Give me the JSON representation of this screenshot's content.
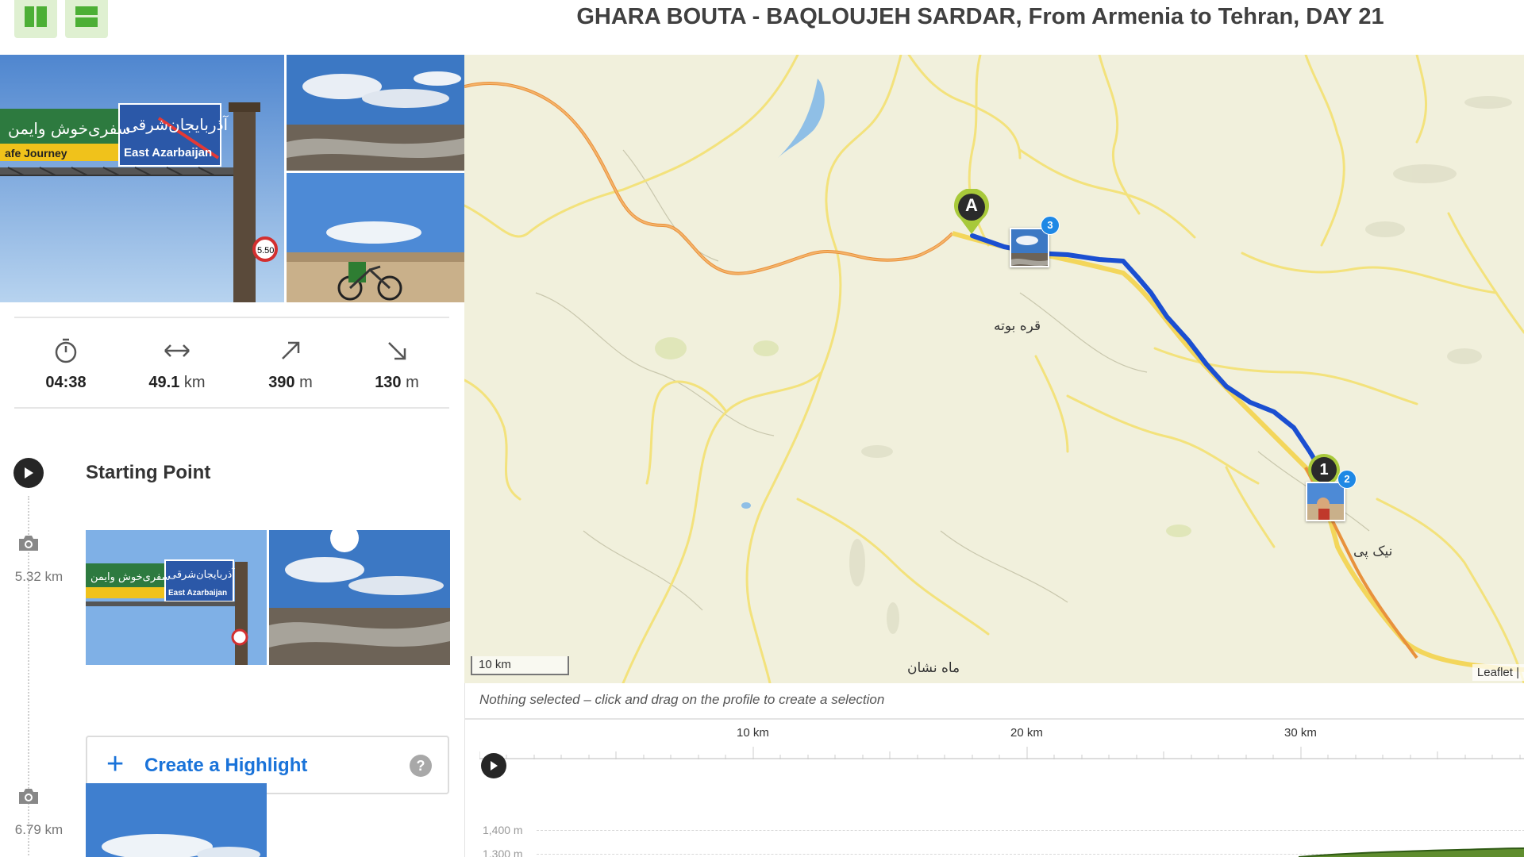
{
  "header": {
    "title": "GHARA BOUTA - BAQLOUJEH SARDAR, From Armenia to Tehran, DAY 21",
    "view_buttons": [
      "split-view-icon",
      "stacked-view-icon"
    ],
    "accent_color": "#dff0d1"
  },
  "stats": {
    "duration": {
      "icon": "stopwatch-icon",
      "value": "04:38",
      "unit": ""
    },
    "distance": {
      "icon": "distance-arrows-icon",
      "value": "49.1",
      "unit": "km"
    },
    "uphill": {
      "icon": "arrow-up-right-icon",
      "value": "390",
      "unit": "m"
    },
    "downhill": {
      "icon": "arrow-down-right-icon",
      "value": "130",
      "unit": "m"
    }
  },
  "timeline": {
    "start_label": "Starting Point",
    "items": [
      {
        "type": "photos",
        "distance": "5.32 km",
        "photo_count": 2
      },
      {
        "type": "photos",
        "distance": "6.79 km",
        "photo_count": 1
      }
    ],
    "highlight_button": {
      "label": "Create a Highlight",
      "help": "?"
    }
  },
  "map": {
    "places": [
      "قره بوته",
      "نیک پی",
      "ماه نشان"
    ],
    "start_marker": "A",
    "waypoint_marker": "1",
    "photo_badges": [
      "3",
      "2"
    ],
    "scale_label": "10 km",
    "attribution": "Leaflet |",
    "route_color": "#1b4fd1",
    "road_color": "#f2a04b"
  },
  "profile": {
    "selection_text": "Nothing selected – click and drag on the profile to create a selection",
    "km_labels": [
      "10 km",
      "20 km",
      "30 km"
    ],
    "elevation_labels": [
      "1,400 m",
      "1,300 m"
    ]
  }
}
